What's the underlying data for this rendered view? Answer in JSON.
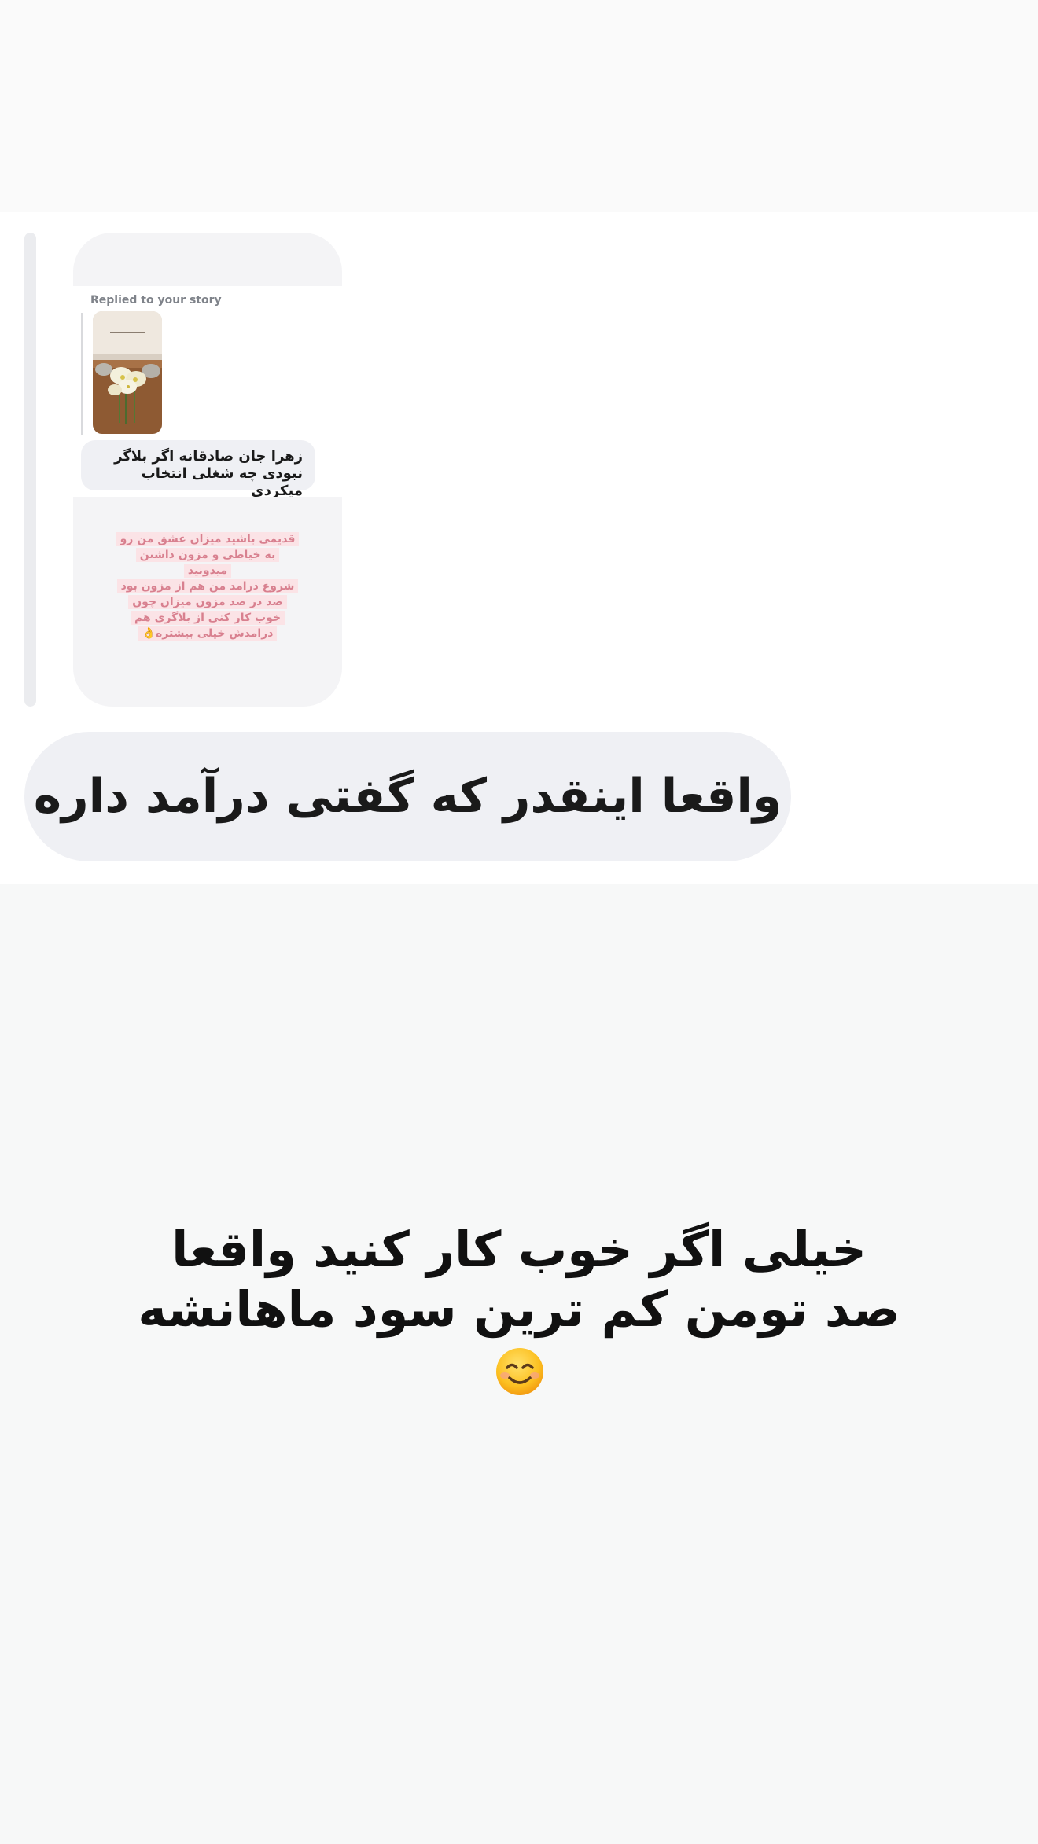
{
  "story_reply": {
    "label": "Replied to your story",
    "reply_message": "زهرا جان  صادقانه اگر بلاگر نبودی چه شغلی انتخاب میکردی",
    "story_lines": [
      "قدیمی باشید میزان عشق من رو",
      "به خیاطی و مزون داشتن",
      "میدونید",
      "شروع درامد من هم از مزون بود",
      "صد در صد مزون میزان چون",
      "خوب کار کنی از بلاگری هم",
      "درامدش خیلی بیشتره👌"
    ]
  },
  "message": {
    "text": "واقعا اینقدر که گفتی درآمد داره"
  },
  "overlay": {
    "line_1": "خیلی اگر خوب کار کنید واقعا",
    "line_2": "صد تومن کم ترین سود ماهانشه",
    "emoji": "smiling-face-icon"
  }
}
